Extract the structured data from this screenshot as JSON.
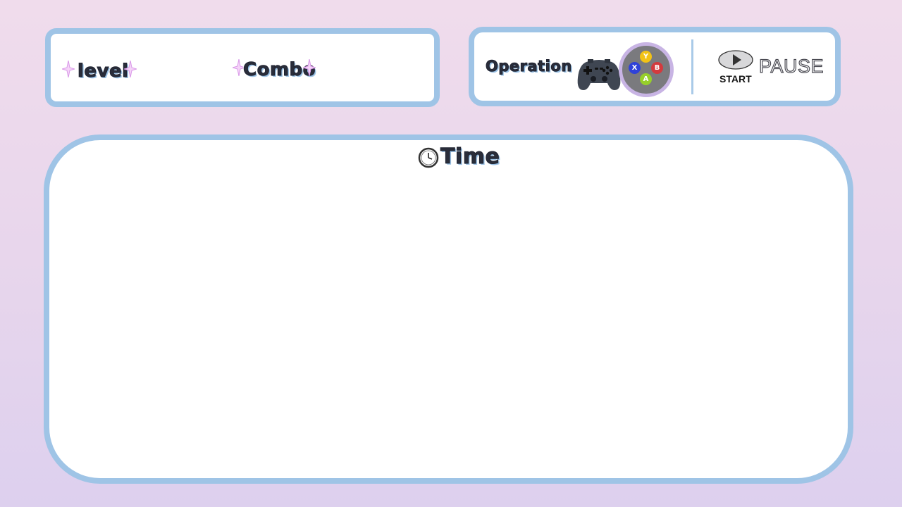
{
  "hud": {
    "level_label": "level",
    "combo_label": "Combo"
  },
  "operation": {
    "label": "Operation",
    "buttons": {
      "y": "Y",
      "x": "X",
      "b": "B",
      "a": "A"
    },
    "start_label": "START",
    "pause_label": "PAUSE"
  },
  "game": {
    "time_label": "Time"
  },
  "colors": {
    "panel_border": "#9fc4e6",
    "accent_spark": "#e8a8f0",
    "btn_y": "#f2c216",
    "btn_x": "#2f42d8",
    "btn_b": "#d33a3e",
    "btn_a": "#97cf2a"
  },
  "icons": [
    "sparkle-icon",
    "gamepad-icon",
    "play-icon",
    "clock-icon"
  ]
}
